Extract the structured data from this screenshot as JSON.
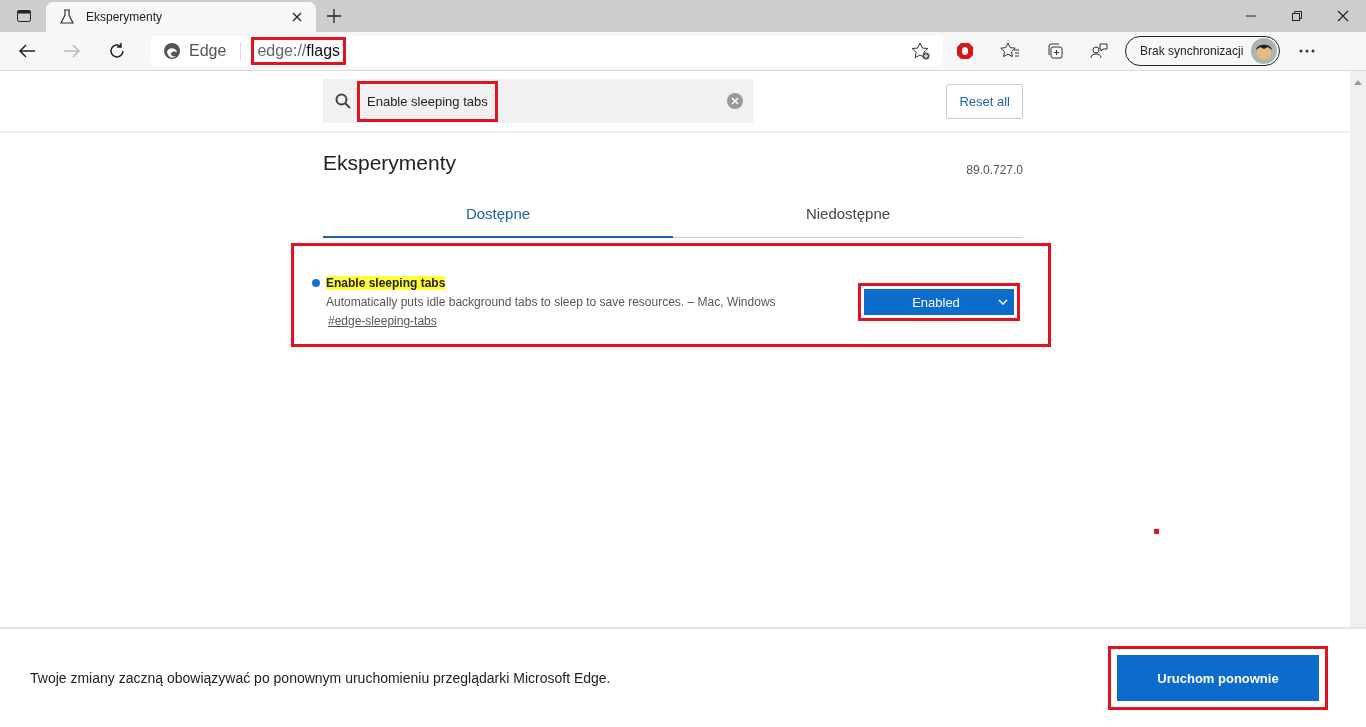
{
  "browser": {
    "tab": {
      "title": "Eksperymenty",
      "selected": true
    },
    "address": {
      "site_label": "Edge",
      "scheme": "edge://",
      "path": "flags",
      "highlighted": true
    },
    "profile": {
      "label": "Brak synchronizacji"
    }
  },
  "search": {
    "value": "Enable sleeping tabs",
    "highlighted": true
  },
  "reset_button": "Reset all",
  "page": {
    "title": "Eksperymenty",
    "version": "89.0.727.0"
  },
  "tabs": [
    {
      "label": "Dostępne",
      "selected": true
    },
    {
      "label": "Niedostępne",
      "selected": false
    }
  ],
  "flags": [
    {
      "name": "Enable sleeping tabs",
      "description": "Automatically puts idle background tabs to sleep to save resources. – Mac, Windows",
      "anchor": "#edge-sleeping-tabs",
      "value": "Enabled",
      "modified": true,
      "highlighted": true,
      "select_highlighted": true
    }
  ],
  "footer": {
    "message": "Twoje zmiany zaczną obowiązywać po ponownym uruchomieniu przeglądarki Microsoft Edge.",
    "button": "Uruchom ponownie",
    "highlighted": true
  },
  "stray_mark": true
}
